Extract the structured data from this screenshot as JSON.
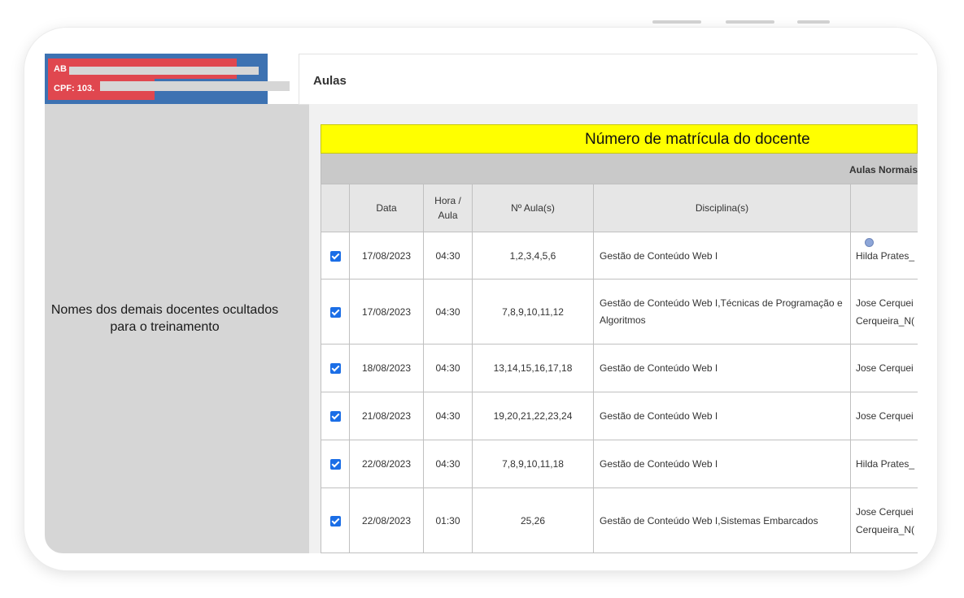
{
  "user": {
    "name_visible": "AB",
    "cpf_visible": "CPF: 103."
  },
  "panel_note": "Nomes dos demais docentes ocultados para o treinamento",
  "header": {
    "title": "Aulas"
  },
  "table": {
    "banner": "Número de matrícula  do docente",
    "section_label": "Aulas Normais",
    "columns": [
      "",
      "Data",
      "Hora / Aula",
      "Nº Aula(s)",
      "Disciplina(s)",
      ""
    ],
    "rows": [
      {
        "checked": true,
        "data": "17/08/2023",
        "hora": "04:30",
        "aulas": "1,2,3,4,5,6",
        "disciplina": "Gestão de Conteúdo Web I",
        "docente": "Hilda Prates_"
      },
      {
        "checked": true,
        "data": "17/08/2023",
        "hora": "04:30",
        "aulas": "7,8,9,10,11,12",
        "disciplina": "Gestão de Conteúdo Web I,Técnicas de Programação e Algoritmos",
        "docente": "Jose Cerquei Cerqueira_N("
      },
      {
        "checked": true,
        "data": "18/08/2023",
        "hora": "04:30",
        "aulas": "13,14,15,16,17,18",
        "disciplina": "Gestão de Conteúdo Web I",
        "docente": "Jose Cerquei"
      },
      {
        "checked": true,
        "data": "21/08/2023",
        "hora": "04:30",
        "aulas": "19,20,21,22,23,24",
        "disciplina": "Gestão de Conteúdo Web I",
        "docente": "Jose Cerquei"
      },
      {
        "checked": true,
        "data": "22/08/2023",
        "hora": "04:30",
        "aulas": "7,8,9,10,11,18",
        "disciplina": "Gestão de Conteúdo Web I",
        "docente": "Hilda Prates_"
      },
      {
        "checked": true,
        "data": "22/08/2023",
        "hora": "01:30",
        "aulas": "25,26",
        "disciplina": "Gestão de Conteúdo Web I,Sistemas Embarcados",
        "docente": "Jose Cerquei Cerqueira_N("
      }
    ]
  },
  "colors": {
    "user_box": "#3d72b2",
    "redaction": "#e0474f",
    "banner": "#ffff00",
    "checkbox": "#1b6ee6"
  }
}
